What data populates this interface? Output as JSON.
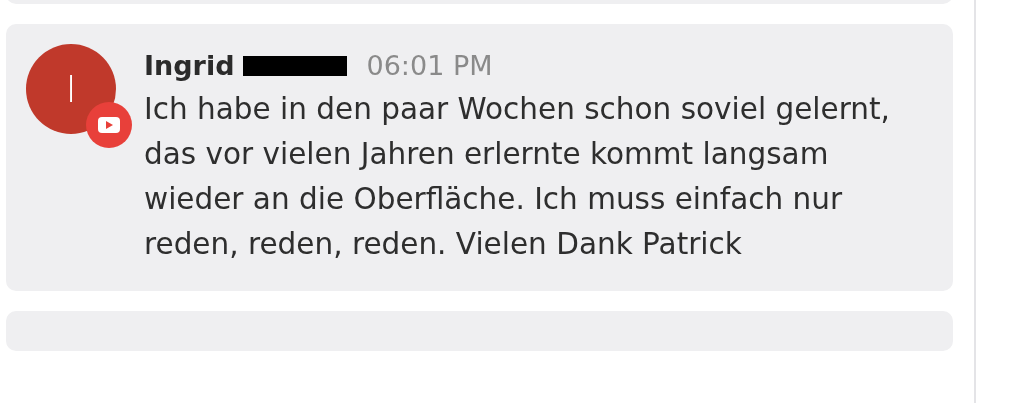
{
  "message": {
    "avatar_initial": "I",
    "author": "Ingrid",
    "author_redacted": true,
    "time": "06:01 PM",
    "text": "Ich habe in den paar Wochen schon soviel gelernt, das vor vielen Jahren erlernte kommt langsam wieder an die Oberfläche. Ich muss einfach nur reden, reden, reden. Vielen Dank Patrick"
  }
}
